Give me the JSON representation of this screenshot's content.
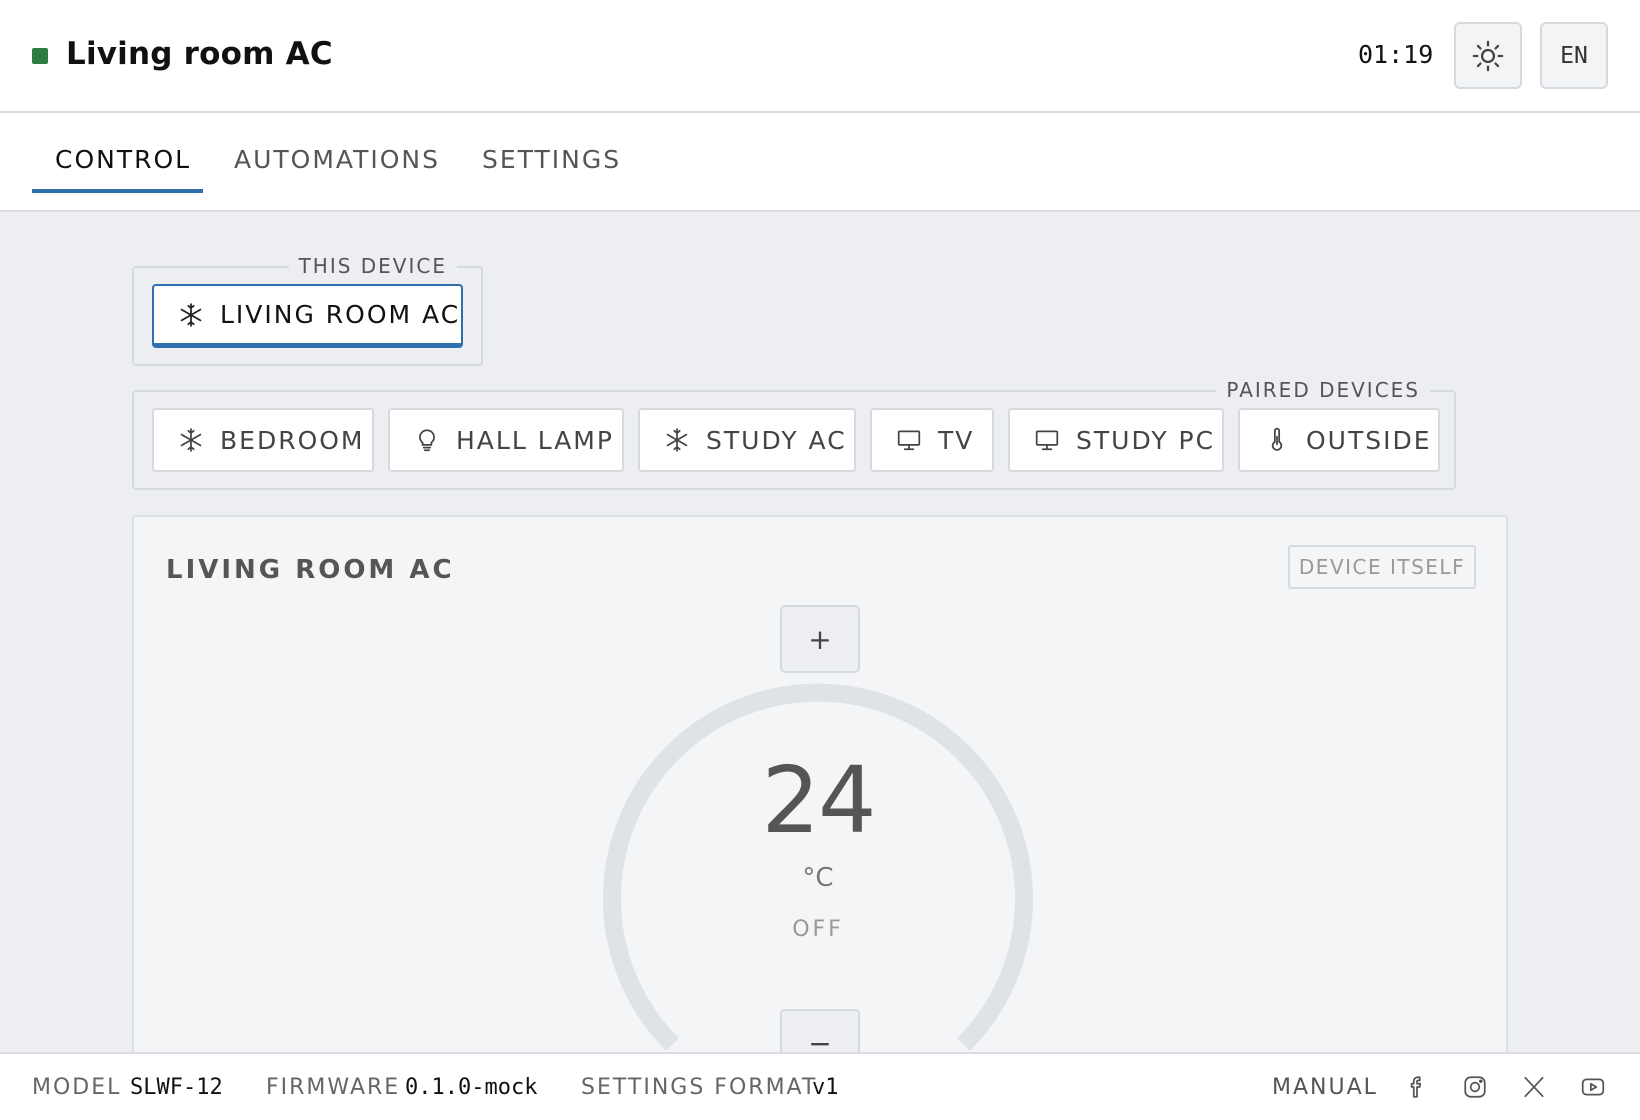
{
  "header": {
    "title": "Living room AC",
    "status_color": "#2e7d45",
    "time": "01:19",
    "theme_icon": "sun-icon",
    "language": "EN"
  },
  "tabs": [
    {
      "label": "CONTROL",
      "active": true
    },
    {
      "label": "AUTOMATIONS",
      "active": false
    },
    {
      "label": "SETTINGS",
      "active": false
    }
  ],
  "this_device": {
    "legend": "THIS DEVICE",
    "device": {
      "label": "LIVING ROOM AC",
      "icon": "snowflake-icon",
      "active": true
    }
  },
  "paired_devices": {
    "legend": "PAIRED DEVICES",
    "items": [
      {
        "label": "BEDROOM",
        "icon": "snowflake-icon"
      },
      {
        "label": "HALL LAMP",
        "icon": "lightbulb-icon"
      },
      {
        "label": "STUDY AC",
        "icon": "snowflake-icon"
      },
      {
        "label": "TV",
        "icon": "monitor-icon"
      },
      {
        "label": "STUDY PC",
        "icon": "monitor-icon"
      },
      {
        "label": "OUTSIDE",
        "icon": "thermometer-icon"
      }
    ]
  },
  "card": {
    "title": "LIVING ROOM AC",
    "badge": "DEVICE ITSELF",
    "increase_label": "+",
    "decrease_label": "−",
    "temperature": "24",
    "unit": "°C",
    "state": "OFF"
  },
  "footer": {
    "model_label": "MODEL",
    "model_value": "SLWF-12",
    "firmware_label": "FIRMWARE",
    "firmware_value": "0.1.0-mock",
    "format_label": "SETTINGS FORMAT",
    "format_value": "v1",
    "manual_label": "MANUAL",
    "social_icons": [
      "facebook-icon",
      "instagram-icon",
      "x-icon",
      "youtube-icon"
    ]
  },
  "colors": {
    "accent": "#2f6fae",
    "status_ok": "#2e7d45",
    "main_bg": "#eceef2",
    "dial_track": "#dfe2e6"
  }
}
